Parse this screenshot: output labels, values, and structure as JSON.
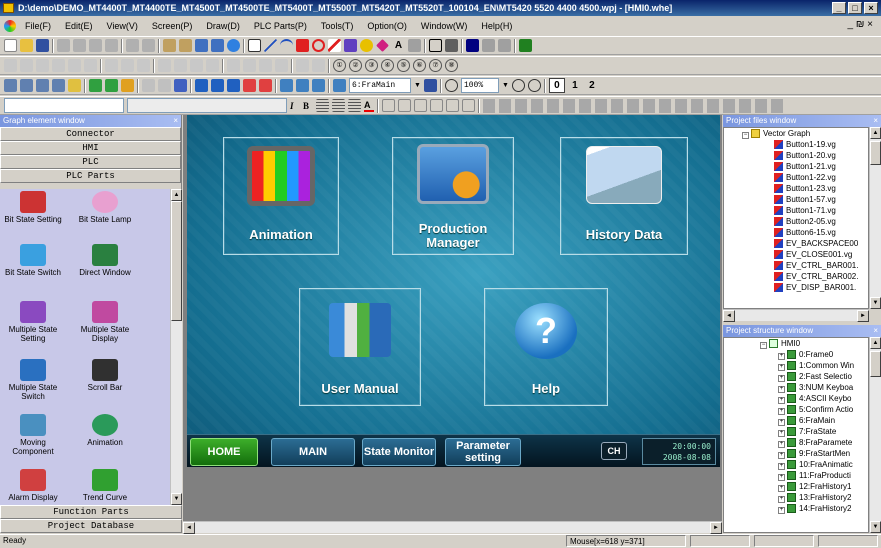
{
  "window": {
    "title": "D:\\demo\\DEMO_MT4400T_MT4400TE_MT4500T_MT4500TE_MT5400T_MT5500T_MT5420T_MT5520T_100104_EN\\MT5420 5520 4400 4500.wpj - [HMI0.whe]",
    "min": "_",
    "max": "□",
    "close": "×",
    "mdi_restore": "_ ₪ ×"
  },
  "menu": [
    "File(F)",
    "Edit(E)",
    "View(V)",
    "Screen(P)",
    "Draw(D)",
    "PLC Parts(P)",
    "Tools(T)",
    "Option(O)",
    "Window(W)",
    "Help(H)"
  ],
  "toolbar": {
    "frame_combo": "6:FraMain",
    "zoom_combo": "100%",
    "page_numbers": [
      "0",
      "1",
      "2"
    ]
  },
  "left_panel": {
    "title": "Graph element window",
    "categories_top": [
      "Connector",
      "HMI",
      "PLC",
      "PLC Parts"
    ],
    "categories_bottom": [
      "Function Parts",
      "Project Database"
    ],
    "parts": [
      {
        "label": "Bit State Setting",
        "color": "#c33"
      },
      {
        "label": "Bit State Lamp",
        "color": "#e8a0d0"
      },
      {
        "label": "Bit State Switch",
        "color": "#3aa0e0"
      },
      {
        "label": "Direct Window",
        "color": "#2a8040"
      },
      {
        "label": "Multiple State Setting",
        "color": "#8a4ac0"
      },
      {
        "label": "Multiple State Display",
        "color": "#c04aa0"
      },
      {
        "label": "Multiple State Switch",
        "color": "#2a70c0"
      },
      {
        "label": "Scroll Bar",
        "color": "#303030"
      },
      {
        "label": "Moving Component",
        "color": "#4a90c0"
      },
      {
        "label": "Animation",
        "color": "#2a9a5a"
      },
      {
        "label": "Alarm Display",
        "color": "#d04040"
      },
      {
        "label": "Trend Curve",
        "color": "#30a030"
      }
    ]
  },
  "hmi_screen": {
    "tiles": [
      {
        "label": "Animation"
      },
      {
        "label": "Production Manager"
      },
      {
        "label": "History Data"
      },
      {
        "label": "User Manual"
      },
      {
        "label": "Help"
      }
    ],
    "help_glyph": "?",
    "nav": {
      "home": "HOME",
      "main": "MAIN",
      "state_monitor": "State Monitor",
      "parameter_setting": "Parameter setting",
      "lang": "CH",
      "time": "20:00:00",
      "date": "2008-08-08"
    }
  },
  "project_files": {
    "title": "Project files window",
    "root": "Vector Graph",
    "items": [
      "Button1-19.vg",
      "Button1-20.vg",
      "Button1-21.vg",
      "Button1-22.vg",
      "Button1-23.vg",
      "Button1-57.vg",
      "Button1-71.vg",
      "Button2-05.vg",
      "Button6-15.vg",
      "EV_BACKSPACE00",
      "EV_CLOSE001.vg",
      "EV_CTRL_BAR001.",
      "EV_CTRL_BAR002.",
      "EV_DISP_BAR001."
    ]
  },
  "project_structure": {
    "title": "Project structure window",
    "root": "HMI0",
    "items": [
      "0:Frame0",
      "1:Common Win",
      "2:Fast Selectio",
      "3:NUM Keyboa",
      "4:ASCII Keybo",
      "5:Confirm Actio",
      "6:FraMain",
      "7:FraState",
      "8:FraParamete",
      "9:FraStartMen",
      "10:FraAnimatic",
      "11:FraProducti",
      "12:FraHistory1",
      "13:FraHistory2",
      "14:FraHistory2"
    ]
  },
  "status": {
    "ready": "Ready",
    "mouse": "Mouse[x=618  y=371]"
  }
}
